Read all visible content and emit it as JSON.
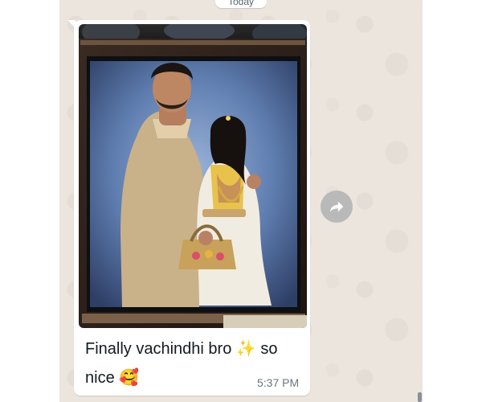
{
  "chat": {
    "date_chip": "Today",
    "message": {
      "photo_alt": "Framed couple photo",
      "caption_text": "Finally vachindhi bro",
      "caption_emoji_1": "✨",
      "caption_text_2": "so",
      "caption_text_3": "nice",
      "caption_emoji_2": "🥰",
      "time": "5:37 PM"
    }
  },
  "colors": {
    "chat_background": "#ece5dd",
    "bubble": "#ffffff",
    "timestamp": "#667781",
    "forward_button": "#b9b9b9"
  },
  "icons": {
    "forward": "forward-icon"
  }
}
